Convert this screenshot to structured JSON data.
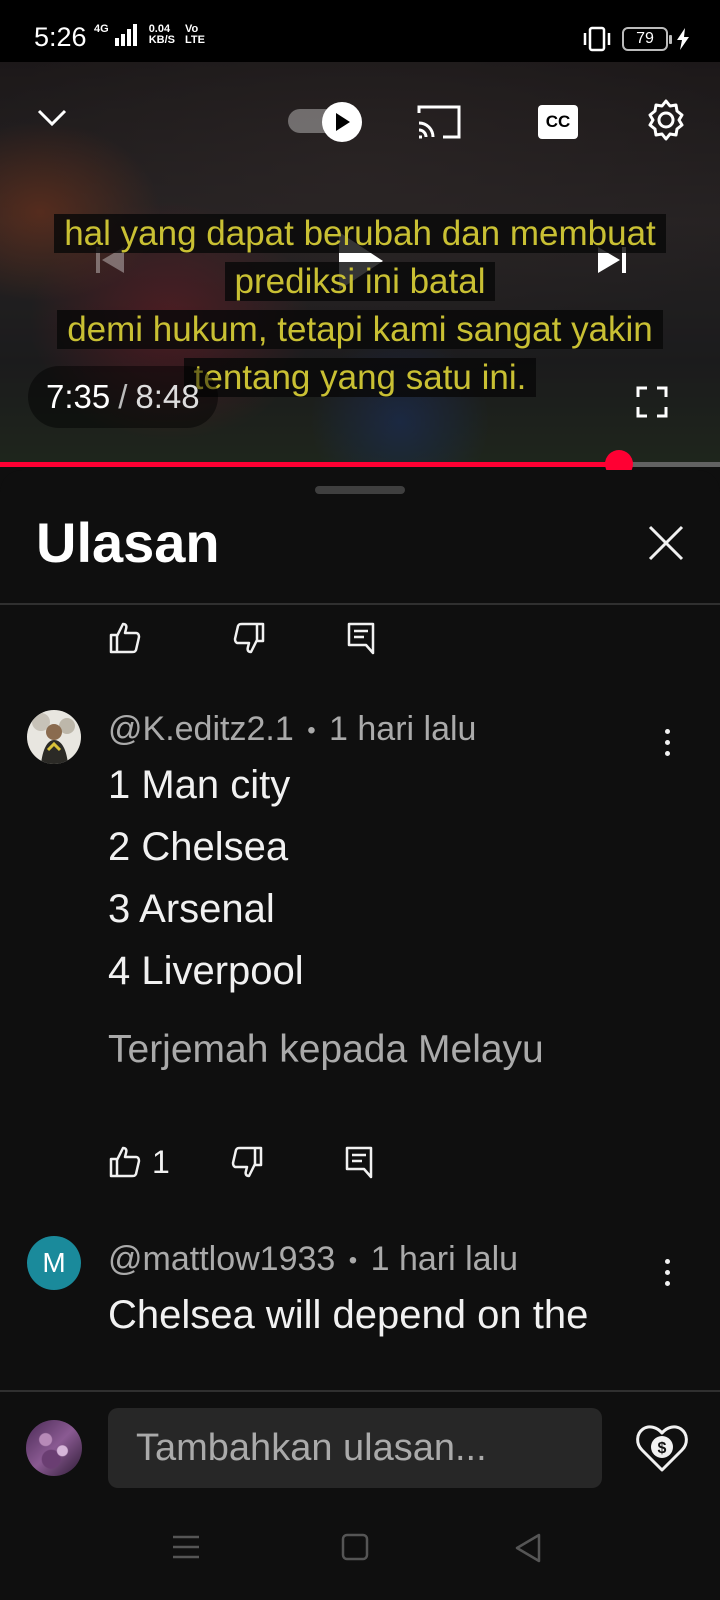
{
  "status_bar": {
    "time": "5:26",
    "network_type": "4G",
    "data_speed": "0.04",
    "data_unit": "KB/S",
    "volte": "Vo",
    "lte": "LTE",
    "battery": "79"
  },
  "player": {
    "captions": [
      "hal yang dapat berubah dan membuat",
      "prediksi ini batal",
      "demi hukum, tetapi kami sangat yakin",
      "tentang yang satu ini."
    ],
    "current_time": "7:35",
    "separator": "/",
    "duration": "8:48",
    "progress": 0.86,
    "cc_label": "CC"
  },
  "comments_panel": {
    "title": "Ulasan",
    "comments": [
      {
        "author": "@K.editz2.1",
        "time": "1 hari lalu",
        "lines": [
          "1 Man city",
          "2 Chelsea",
          "3 Arsenal",
          "4 Liverpool"
        ],
        "translate": "Terjemah kepada Melayu",
        "likes": "1"
      },
      {
        "author": "@mattlow1933",
        "avatar_letter": "M",
        "avatar_color": "#1a8a9b",
        "time": "1 hari lalu",
        "lines": [
          "Chelsea will depend on the"
        ]
      }
    ],
    "dot": "•"
  },
  "input": {
    "placeholder": "Tambahkan ulasan..."
  },
  "colors": {
    "accent": "#ff0033",
    "caption_text": "#c9c033",
    "background": "#0f0f0f"
  }
}
